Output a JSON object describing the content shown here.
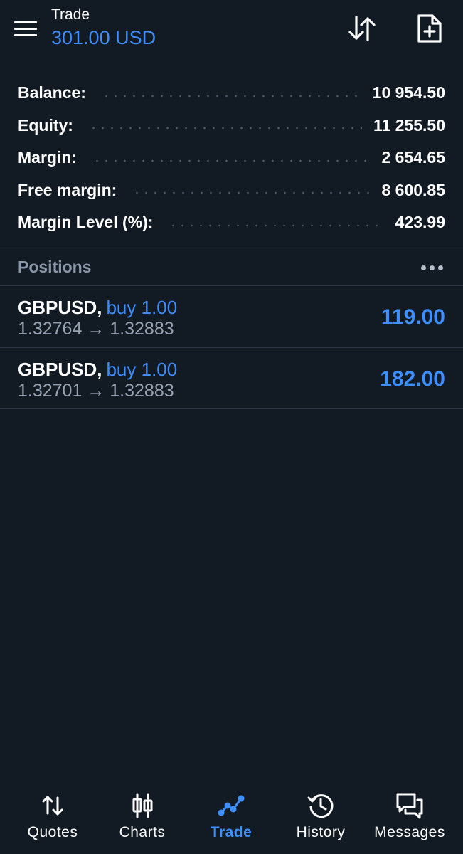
{
  "header": {
    "title": "Trade",
    "subtitle": "301.00 USD"
  },
  "summary": [
    {
      "label": "Balance:",
      "value": "10 954.50"
    },
    {
      "label": "Equity:",
      "value": "11 255.50"
    },
    {
      "label": "Margin:",
      "value": "2 654.65"
    },
    {
      "label": "Free margin:",
      "value": "8 600.85"
    },
    {
      "label": "Margin Level (%):",
      "value": "423.99"
    }
  ],
  "positions": {
    "title": "Positions",
    "items": [
      {
        "symbol": "GBPUSD,",
        "side": "buy 1.00",
        "prices": "1.32764 → 1.32883",
        "profit": "119.00"
      },
      {
        "symbol": "GBPUSD,",
        "side": "buy 1.00",
        "prices": "1.32701 → 1.32883",
        "profit": "182.00"
      }
    ]
  },
  "nav": {
    "items": [
      {
        "label": "Quotes",
        "icon": "arrows-updown-icon"
      },
      {
        "label": "Charts",
        "icon": "candlestick-icon"
      },
      {
        "label": "Trade",
        "icon": "trend-line-icon"
      },
      {
        "label": "History",
        "icon": "history-icon"
      },
      {
        "label": "Messages",
        "icon": "chat-icon"
      }
    ],
    "active": "Trade"
  },
  "colors": {
    "background": "#121a24",
    "accent": "#3d8fff",
    "muted": "#8997a8",
    "divider": "#2c3642"
  }
}
